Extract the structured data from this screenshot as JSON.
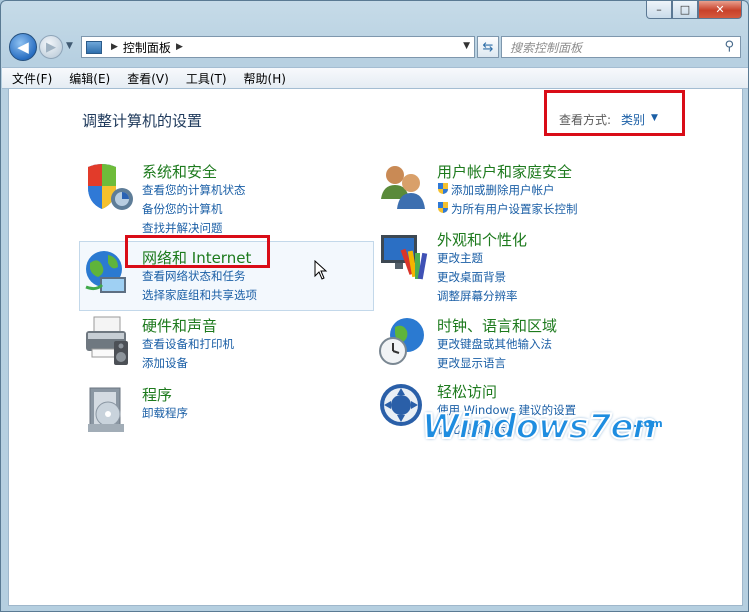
{
  "window": {
    "buttons": {
      "minimize": "–",
      "maximize": "□",
      "close": "✕"
    }
  },
  "address_bar": {
    "breadcrumb": "控制面板",
    "search_placeholder": "搜索控制面板"
  },
  "menu": [
    "文件(F)",
    "编辑(E)",
    "查看(V)",
    "工具(T)",
    "帮助(H)"
  ],
  "page": {
    "title": "调整计算机的设置",
    "view_by_label": "查看方式:",
    "view_by_value": "类别"
  },
  "categories": [
    {
      "title": "系统和安全",
      "icon": "shield-icon",
      "links": [
        "查看您的计算机状态",
        "备份您的计算机",
        "查找并解决问题"
      ]
    },
    {
      "title": "网络和 Internet",
      "icon": "network-globe-icon",
      "links": [
        "查看网络状态和任务",
        "选择家庭组和共享选项"
      ]
    },
    {
      "title": "硬件和声音",
      "icon": "printer-icon",
      "links": [
        "查看设备和打印机",
        "添加设备"
      ]
    },
    {
      "title": "程序",
      "icon": "programs-icon",
      "links": [
        "卸载程序"
      ]
    },
    {
      "title": "用户帐户和家庭安全",
      "icon": "users-icon",
      "links": [
        "添加或删除用户帐户",
        "为所有用户设置家长控制"
      ]
    },
    {
      "title": "外观和个性化",
      "icon": "monitor-palette-icon",
      "links": [
        "更改主题",
        "更改桌面背景",
        "调整屏幕分辨率"
      ]
    },
    {
      "title": "时钟、语言和区域",
      "icon": "clock-globe-icon",
      "links": [
        "更改键盘或其他输入法",
        "更改显示语言"
      ]
    },
    {
      "title": "轻松访问",
      "icon": "ease-of-access-icon",
      "links": [
        "使用 Windows 建议的设置",
        "优化视频显示"
      ]
    }
  ],
  "watermark": {
    "text": "Windows7en",
    "suffix": ".com"
  }
}
